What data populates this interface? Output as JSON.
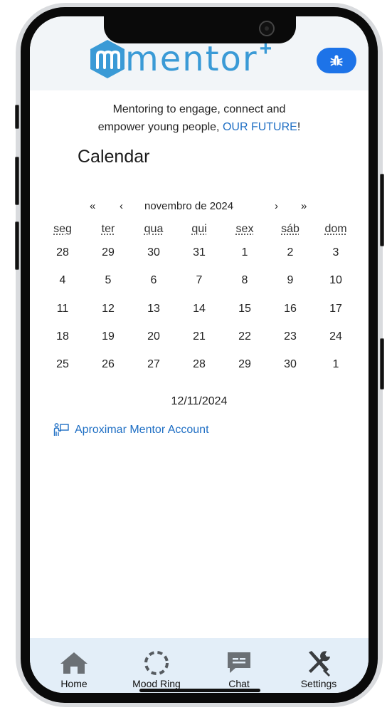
{
  "header": {
    "logo_text": "mentor",
    "logo_plus": "+",
    "bug_icon": "bug-icon"
  },
  "tagline": {
    "line1": "Mentoring to engage, connect and",
    "line2_prefix": "empower young people, ",
    "line2_link": "OUR FUTURE",
    "line2_suffix": "!"
  },
  "page_title": "Calendar",
  "calendar": {
    "prev_year": "«",
    "prev_month": "‹",
    "month_label": "novembro de 2024",
    "next_month": "›",
    "next_year": "»",
    "weekdays": [
      "seg",
      "ter",
      "qua",
      "qui",
      "sex",
      "sáb",
      "dom"
    ],
    "weeks": [
      [
        "28",
        "29",
        "30",
        "31",
        "1",
        "2",
        "3"
      ],
      [
        "4",
        "5",
        "6",
        "7",
        "8",
        "9",
        "10"
      ],
      [
        "11",
        "12",
        "13",
        "14",
        "15",
        "16",
        "17"
      ],
      [
        "18",
        "19",
        "20",
        "21",
        "22",
        "23",
        "24"
      ],
      [
        "25",
        "26",
        "27",
        "28",
        "29",
        "30",
        "1"
      ]
    ]
  },
  "selected_date": "12/11/2024",
  "account_link": {
    "icon": "person-board-icon",
    "label": "Aproximar Mentor Account"
  },
  "tabs": [
    {
      "label": "Home",
      "icon": "home-icon"
    },
    {
      "label": "Mood Ring",
      "icon": "mood-ring-icon"
    },
    {
      "label": "Chat",
      "icon": "chat-icon"
    },
    {
      "label": "Settings",
      "icon": "settings-icon"
    }
  ],
  "colors": {
    "brand": "#3a9ad6",
    "link": "#1f6fc4",
    "bug_button": "#1d73e8",
    "tabbar": "#e3eef8",
    "icon_gray": "#6b7075"
  }
}
